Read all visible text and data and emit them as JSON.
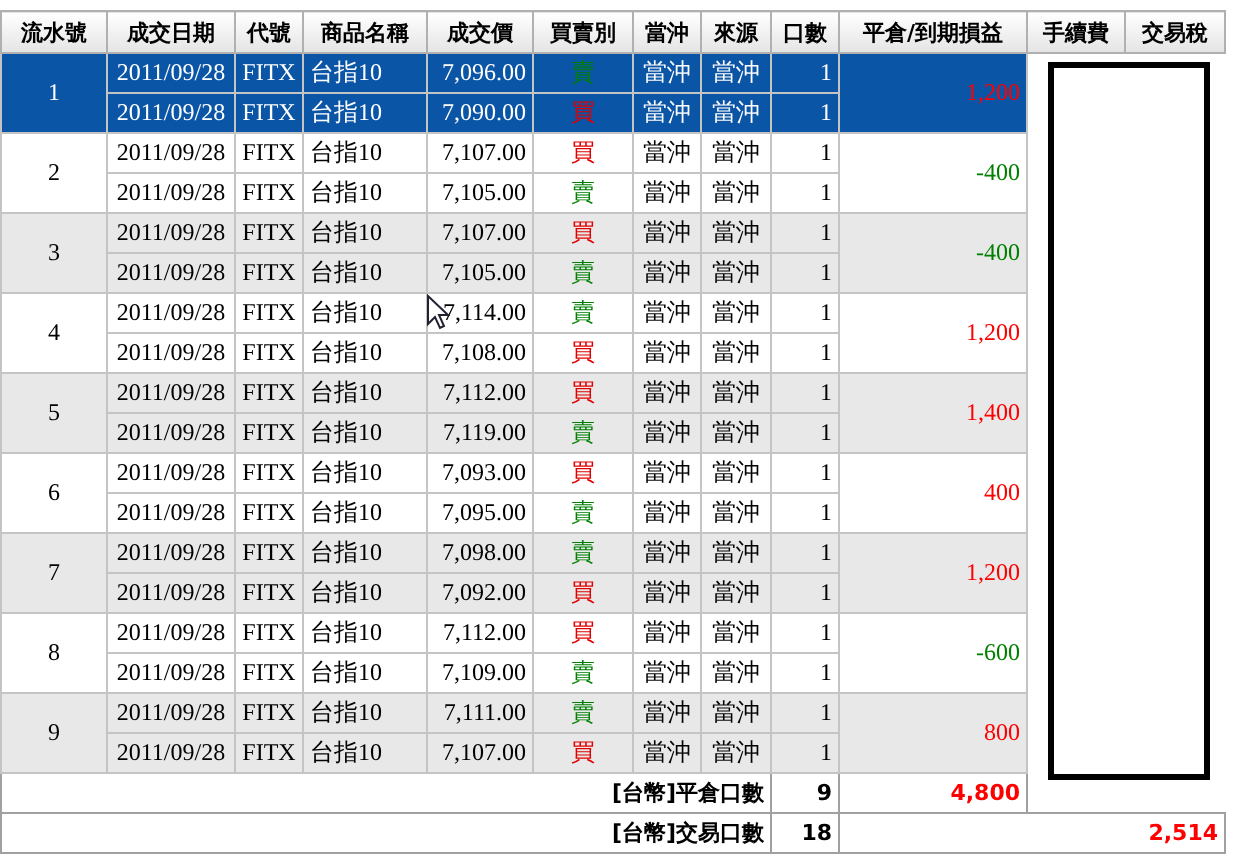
{
  "columns": [
    "流水號",
    "成交日期",
    "代號",
    "商品名稱",
    "成交價",
    "買賣別",
    "當沖",
    "來源",
    "口數",
    "平倉/到期損益",
    "手續費",
    "交易稅"
  ],
  "groups": [
    {
      "no": "1",
      "selected": true,
      "pnl": "1,200",
      "color": "#ff0000",
      "legs": [
        {
          "date": "2011/09/28",
          "code": "FITX",
          "name": "台指10",
          "price": "7,096.00",
          "kind": "sell",
          "side": "賣",
          "daytrade": "當沖",
          "source": "當沖",
          "qty": "1"
        },
        {
          "date": "2011/09/28",
          "code": "FITX",
          "name": "台指10",
          "price": "7,090.00",
          "kind": "buy",
          "side": "買",
          "daytrade": "當沖",
          "source": "當沖",
          "qty": "1"
        }
      ]
    },
    {
      "no": "2",
      "selected": false,
      "pnl": "-400",
      "color": "#008000",
      "legs": [
        {
          "date": "2011/09/28",
          "code": "FITX",
          "name": "台指10",
          "price": "7,107.00",
          "kind": "buy",
          "side": "買",
          "daytrade": "當沖",
          "source": "當沖",
          "qty": "1"
        },
        {
          "date": "2011/09/28",
          "code": "FITX",
          "name": "台指10",
          "price": "7,105.00",
          "kind": "sell",
          "side": "賣",
          "daytrade": "當沖",
          "source": "當沖",
          "qty": "1"
        }
      ]
    },
    {
      "no": "3",
      "selected": false,
      "pnl": "-400",
      "color": "#008000",
      "legs": [
        {
          "date": "2011/09/28",
          "code": "FITX",
          "name": "台指10",
          "price": "7,107.00",
          "kind": "buy",
          "side": "買",
          "daytrade": "當沖",
          "source": "當沖",
          "qty": "1"
        },
        {
          "date": "2011/09/28",
          "code": "FITX",
          "name": "台指10",
          "price": "7,105.00",
          "kind": "sell",
          "side": "賣",
          "daytrade": "當沖",
          "source": "當沖",
          "qty": "1"
        }
      ]
    },
    {
      "no": "4",
      "selected": false,
      "pnl": "1,200",
      "color": "#ff0000",
      "legs": [
        {
          "date": "2011/09/28",
          "code": "FITX",
          "name": "台指10",
          "price": "7,114.00",
          "kind": "sell",
          "side": "賣",
          "daytrade": "當沖",
          "source": "當沖",
          "qty": "1"
        },
        {
          "date": "2011/09/28",
          "code": "FITX",
          "name": "台指10",
          "price": "7,108.00",
          "kind": "buy",
          "side": "買",
          "daytrade": "當沖",
          "source": "當沖",
          "qty": "1"
        }
      ]
    },
    {
      "no": "5",
      "selected": false,
      "pnl": "1,400",
      "color": "#ff0000",
      "legs": [
        {
          "date": "2011/09/28",
          "code": "FITX",
          "name": "台指10",
          "price": "7,112.00",
          "kind": "buy",
          "side": "買",
          "daytrade": "當沖",
          "source": "當沖",
          "qty": "1"
        },
        {
          "date": "2011/09/28",
          "code": "FITX",
          "name": "台指10",
          "price": "7,119.00",
          "kind": "sell",
          "side": "賣",
          "daytrade": "當沖",
          "source": "當沖",
          "qty": "1"
        }
      ]
    },
    {
      "no": "6",
      "selected": false,
      "pnl": "400",
      "color": "#ff0000",
      "legs": [
        {
          "date": "2011/09/28",
          "code": "FITX",
          "name": "台指10",
          "price": "7,093.00",
          "kind": "buy",
          "side": "買",
          "daytrade": "當沖",
          "source": "當沖",
          "qty": "1"
        },
        {
          "date": "2011/09/28",
          "code": "FITX",
          "name": "台指10",
          "price": "7,095.00",
          "kind": "sell",
          "side": "賣",
          "daytrade": "當沖",
          "source": "當沖",
          "qty": "1"
        }
      ]
    },
    {
      "no": "7",
      "selected": false,
      "pnl": "1,200",
      "color": "#ff0000",
      "legs": [
        {
          "date": "2011/09/28",
          "code": "FITX",
          "name": "台指10",
          "price": "7,098.00",
          "kind": "sell",
          "side": "賣",
          "daytrade": "當沖",
          "source": "當沖",
          "qty": "1"
        },
        {
          "date": "2011/09/28",
          "code": "FITX",
          "name": "台指10",
          "price": "7,092.00",
          "kind": "buy",
          "side": "買",
          "daytrade": "當沖",
          "source": "當沖",
          "qty": "1"
        }
      ]
    },
    {
      "no": "8",
      "selected": false,
      "pnl": "-600",
      "color": "#008000",
      "legs": [
        {
          "date": "2011/09/28",
          "code": "FITX",
          "name": "台指10",
          "price": "7,112.00",
          "kind": "buy",
          "side": "買",
          "daytrade": "當沖",
          "source": "當沖",
          "qty": "1"
        },
        {
          "date": "2011/09/28",
          "code": "FITX",
          "name": "台指10",
          "price": "7,109.00",
          "kind": "sell",
          "side": "賣",
          "daytrade": "當沖",
          "source": "當沖",
          "qty": "1"
        }
      ]
    },
    {
      "no": "9",
      "selected": false,
      "pnl": "800",
      "color": "#ff0000",
      "legs": [
        {
          "date": "2011/09/28",
          "code": "FITX",
          "name": "台指10",
          "price": "7,111.00",
          "kind": "sell",
          "side": "賣",
          "daytrade": "當沖",
          "source": "當沖",
          "qty": "1"
        },
        {
          "date": "2011/09/28",
          "code": "FITX",
          "name": "台指10",
          "price": "7,107.00",
          "kind": "buy",
          "side": "買",
          "daytrade": "當沖",
          "source": "當沖",
          "qty": "1"
        }
      ]
    }
  ],
  "totals": [
    {
      "kind": "close",
      "label": "[台幣]平倉口數",
      "qty": "9",
      "value": "4,800"
    },
    {
      "kind": "trade",
      "label": "[台幣]交易口數",
      "qty": "18",
      "value": "2,514"
    }
  ]
}
